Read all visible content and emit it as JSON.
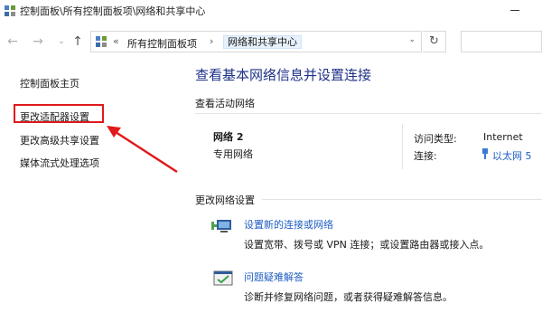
{
  "window": {
    "title": "控制面板\\所有控制面板项\\网络和共享中心"
  },
  "address_bar": {
    "prefix": "«",
    "crumb1": "所有控制面板项",
    "separator": "›",
    "crumb2": "网络和共享中心",
    "dropdown": "⌄",
    "refresh": "↻"
  },
  "sidebar": {
    "home": "控制面板主页",
    "adapter": "更改适配器设置",
    "advanced": "更改高级共享设置",
    "media": "媒体流式处理选项"
  },
  "main": {
    "title": "查看基本网络信息并设置连接",
    "active_label": "查看活动网络",
    "network_name": "网络 2",
    "network_type": "专用网络",
    "access_type_label": "访问类型:",
    "access_type_value": "Internet",
    "connection_label": "连接:",
    "connection_value": "以太网 5",
    "change_label": "更改网络设置",
    "tasks": [
      {
        "link": "设置新的连接或网络",
        "desc": "设置宽带、拨号或 VPN 连接；或设置路由器或接入点。"
      },
      {
        "link": "问题疑难解答",
        "desc": "诊断并修复网络问题，或者获得疑难解答信息。"
      }
    ]
  },
  "colors": {
    "link": "#1f5ec4",
    "title": "#1e3287",
    "annotation_red": "#e0191b"
  },
  "icons": [
    "app-icon",
    "back-icon",
    "forward-icon",
    "recent-dropdown-icon",
    "up-icon",
    "address-icon",
    "refresh-icon",
    "plug-icon",
    "new-connection-icon",
    "troubleshoot-icon"
  ]
}
